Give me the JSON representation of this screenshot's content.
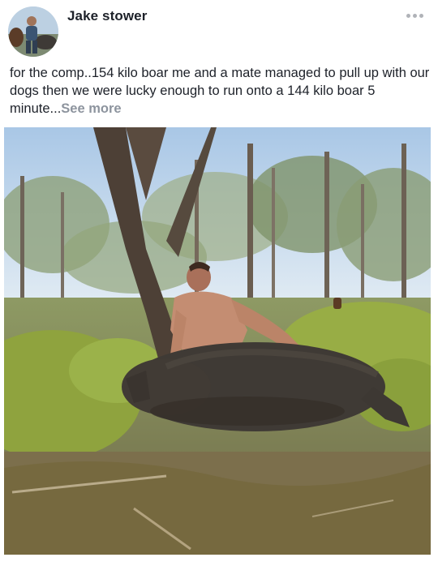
{
  "post": {
    "author": "Jake stower",
    "caption_text": "for the comp..154 kilo boar me and a mate managed to pull up with our dogs then we were lucky enough to run onto a 144 kilo boar 5 minute...",
    "see_more_label": "See more"
  },
  "icons": {
    "menu": "more-options-icon"
  },
  "colors": {
    "author_text": "#1d2129",
    "body_text": "#1d2129",
    "see_more": "#8d949e",
    "menu_dots": "#b0b3b8"
  }
}
